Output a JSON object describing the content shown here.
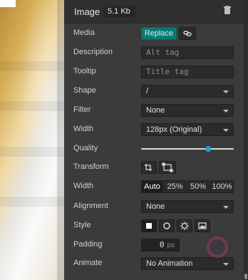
{
  "header": {
    "title": "Image",
    "size": "5.1 Kb"
  },
  "rows": {
    "media": {
      "label": "Media",
      "replace": "Replace"
    },
    "description": {
      "label": "Description",
      "placeholder": "Alt tag"
    },
    "tooltip": {
      "label": "Tooltip",
      "placeholder": "Title tag"
    },
    "shape": {
      "label": "Shape",
      "value": "/"
    },
    "filter": {
      "label": "Filter",
      "value": "None"
    },
    "width_select": {
      "label": "Width",
      "value": "128px (Original)"
    },
    "quality": {
      "label": "Quality",
      "value": 0.72
    },
    "transform": {
      "label": "Transform"
    },
    "width_buttons": {
      "label": "Width",
      "options": [
        "Auto",
        "25%",
        "50%",
        "100%"
      ],
      "selected": "Auto"
    },
    "alignment": {
      "label": "Alignment",
      "value": "None"
    },
    "style": {
      "label": "Style"
    },
    "padding": {
      "label": "Padding",
      "value": "0",
      "unit": "px"
    },
    "animate": {
      "label": "Animate",
      "value": "No Animation"
    }
  },
  "colors": {
    "accent": "#0a7b73",
    "slider_thumb": "#19a6d8",
    "panel_bg": "#3b3b3b"
  },
  "icons": [
    "trash-icon",
    "link-icon",
    "crop-icon",
    "transform-icon",
    "square-style-icon",
    "circle-style-icon",
    "gear-style-icon",
    "image-style-icon"
  ]
}
